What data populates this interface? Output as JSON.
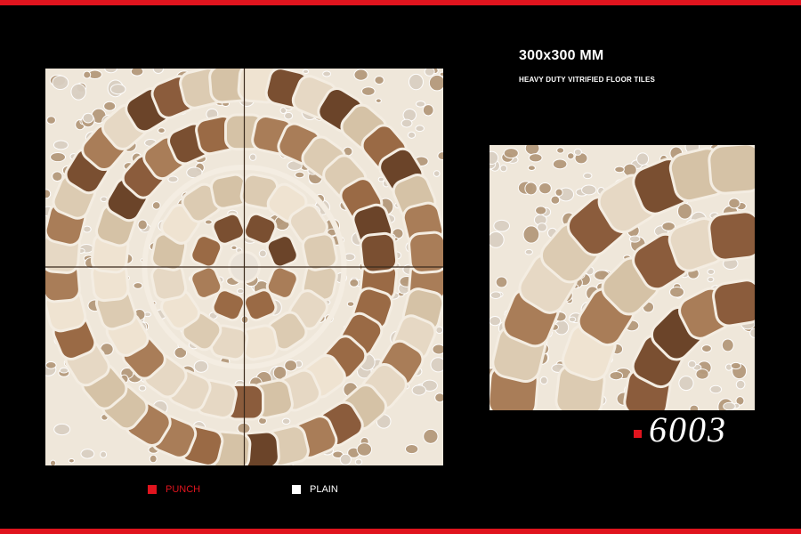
{
  "colors": {
    "accent": "#e0141e",
    "background": "#000000",
    "tile_grout": "#efe7da",
    "stone_dark": "#6b4429",
    "stone_mid": "#8b5c3c",
    "stone_light": "#e6d8c4",
    "pebble": "#b59a7c"
  },
  "header": {
    "size": "300x300 MM",
    "description": "HEAVY DUTY VITRIFIED FLOOR TILES"
  },
  "product": {
    "code": "6003"
  },
  "legend": {
    "punch_label": "PUNCH",
    "plain_label": "PLAIN"
  },
  "images": {
    "laid_pattern_icon": "four-tile-circle-pattern",
    "single_tile_icon": "single-tile-quarter-circle"
  }
}
